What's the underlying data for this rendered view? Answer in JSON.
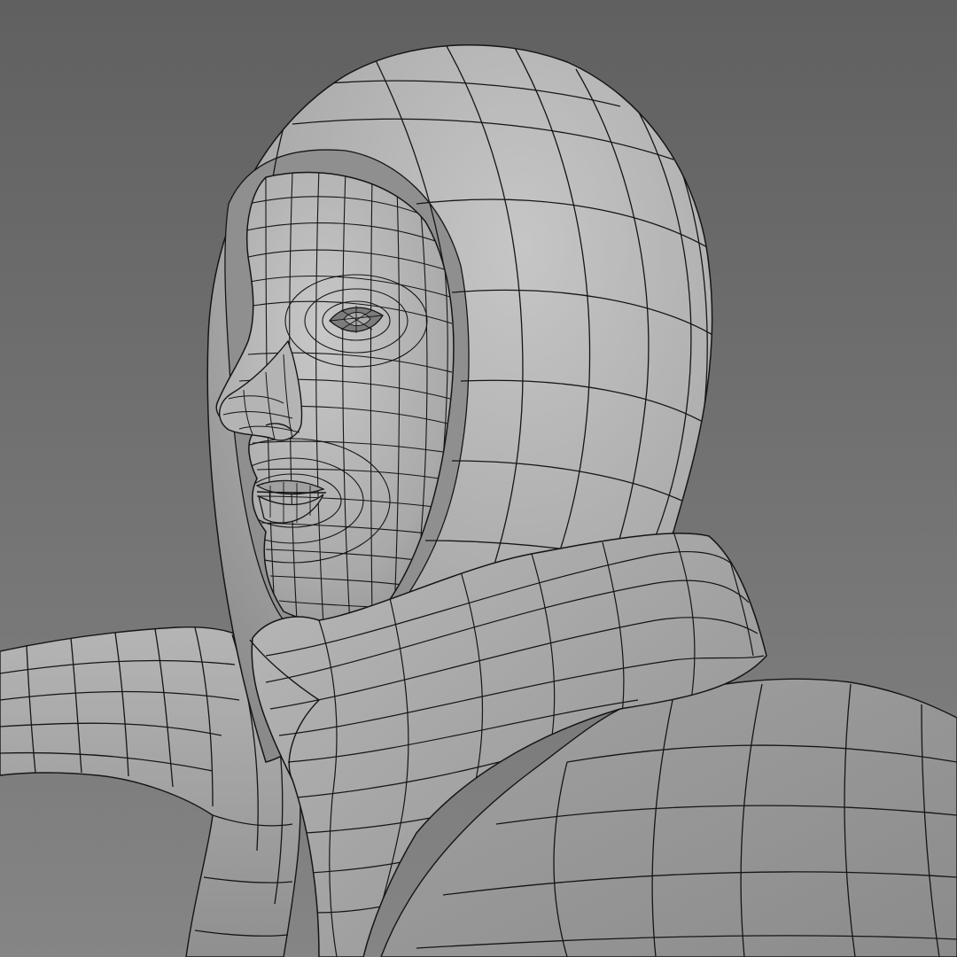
{
  "viewport": {
    "render_mode": "smooth-shaded-with-wireframe",
    "colors": {
      "background_top": "#606060",
      "background_bottom": "#858585",
      "mesh_light": "#c4c4c4",
      "mesh_mid": "#a7a7a7",
      "mesh_dark": "#7a7a7a",
      "wire": "#151515"
    }
  },
  "model": {
    "parts": [
      "hood",
      "face",
      "eye",
      "nose",
      "lips",
      "scarf",
      "arm",
      "torso"
    ]
  }
}
